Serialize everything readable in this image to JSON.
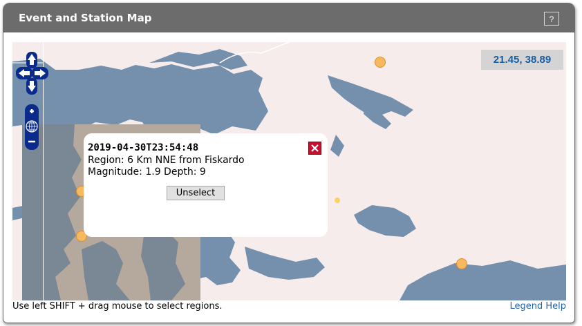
{
  "panel": {
    "title": "Event and Station Map",
    "help_label": "?"
  },
  "map": {
    "coordinates": "21.45, 38.89",
    "nav_icons": [
      "pan-up-icon",
      "pan-left-icon",
      "pan-right-icon",
      "pan-down-icon",
      "zoom-in-icon",
      "zoom-world-icon",
      "zoom-out-icon"
    ],
    "colors": {
      "land": "#f7ecec",
      "sea": "#7490ad",
      "selected_region_land": "#f6dcc4",
      "event_marker": "#f7b95f",
      "marker_outline": "#e08b28",
      "dim_overlay": "#808080"
    }
  },
  "popup": {
    "time": "2019-04-30T23:54:48",
    "region": "Region: 6 Km NNE from Fiskardo",
    "magnitude_depth": "Magnitude: 1.9 Depth: 9",
    "unselect_label": "Unselect"
  },
  "footer": {
    "hint": "Use left SHIFT + drag mouse to select regions.",
    "legend_link": "Legend Help"
  }
}
